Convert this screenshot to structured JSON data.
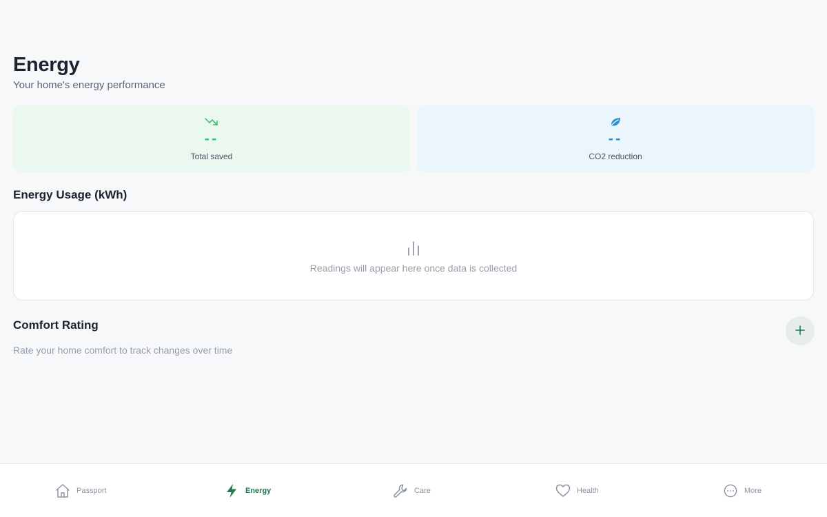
{
  "header": {
    "title": "Energy",
    "subtitle": "Your home's energy performance"
  },
  "stats": [
    {
      "icon": "trending-down-icon",
      "value": "--",
      "label": "Total saved",
      "color": "#41c26b"
    },
    {
      "icon": "leaf-icon",
      "value": "--",
      "label": "CO2 reduction",
      "color": "#2b93d1"
    }
  ],
  "energy_usage": {
    "title": "Energy Usage (kWh)",
    "icon": "bar-chart-icon",
    "empty_message": "Readings will appear here once data is collected"
  },
  "comfort": {
    "title": "Comfort Rating",
    "subtitle": "Rate your home comfort to track changes over time",
    "add_icon": "plus-icon"
  },
  "nav": {
    "active": "Energy",
    "accent": "#227b4e",
    "items": [
      {
        "label": "Passport",
        "icon": "home-icon"
      },
      {
        "label": "Energy",
        "icon": "lightning-icon"
      },
      {
        "label": "Care",
        "icon": "wrench-icon"
      },
      {
        "label": "Health",
        "icon": "heart-icon"
      },
      {
        "label": "More",
        "icon": "more-circle-icon"
      }
    ]
  }
}
